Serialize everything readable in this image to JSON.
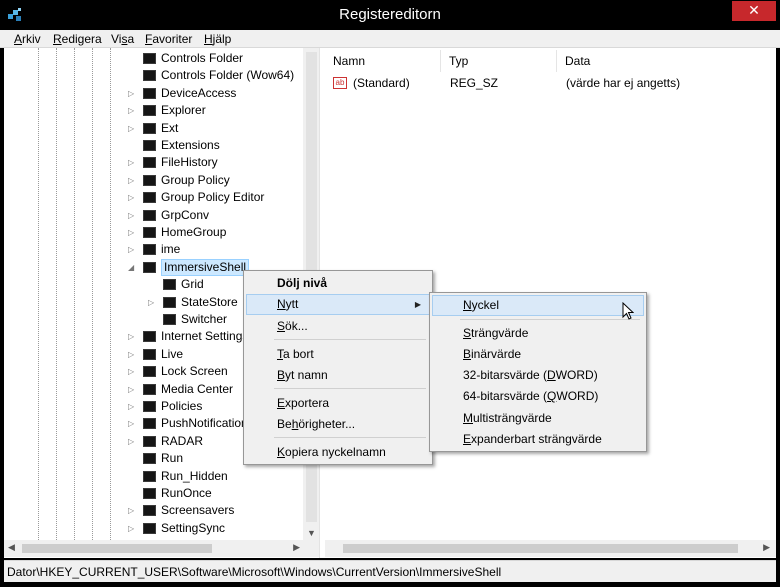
{
  "window": {
    "title": "Registereditorn",
    "close_glyph": "✕"
  },
  "menu": [
    {
      "label": "Arkiv",
      "accel": "A"
    },
    {
      "label": "Redigera",
      "accel": "R"
    },
    {
      "label": "Visa",
      "accel": "s"
    },
    {
      "label": "Favoriter",
      "accel": "F"
    },
    {
      "label": "Hjälp",
      "accel": "H"
    }
  ],
  "tree": {
    "items": [
      {
        "label": "Controls Folder",
        "expander": false
      },
      {
        "label": "Controls Folder (Wow64)",
        "expander": false
      },
      {
        "label": "DeviceAccess",
        "expander": true
      },
      {
        "label": "Explorer",
        "expander": true
      },
      {
        "label": "Ext",
        "expander": true
      },
      {
        "label": "Extensions",
        "expander": false
      },
      {
        "label": "FileHistory",
        "expander": true
      },
      {
        "label": "Group Policy",
        "expander": true
      },
      {
        "label": "Group Policy Editor",
        "expander": true
      },
      {
        "label": "GrpConv",
        "expander": true
      },
      {
        "label": "HomeGroup",
        "expander": true
      },
      {
        "label": "ime",
        "expander": true
      },
      {
        "label": "ImmersiveShell",
        "expander": true,
        "expanded": true,
        "selected": true
      },
      {
        "label": "Grid",
        "child": true,
        "expander": false
      },
      {
        "label": "StateStore",
        "child": true,
        "expander": true
      },
      {
        "label": "Switcher",
        "child": true,
        "expander": false
      },
      {
        "label": "Internet Settings",
        "expander": true
      },
      {
        "label": "Live",
        "expander": true
      },
      {
        "label": "Lock Screen",
        "expander": true
      },
      {
        "label": "Media Center",
        "expander": true
      },
      {
        "label": "Policies",
        "expander": true
      },
      {
        "label": "PushNotifications",
        "expander": true
      },
      {
        "label": "RADAR",
        "expander": true
      },
      {
        "label": "Run",
        "expander": false
      },
      {
        "label": "Run_Hidden",
        "expander": false
      },
      {
        "label": "RunOnce",
        "expander": false
      },
      {
        "label": "Screensavers",
        "expander": true
      },
      {
        "label": "SettingSync",
        "expander": true
      }
    ]
  },
  "list": {
    "columns": [
      "Namn",
      "Typ",
      "Data"
    ],
    "rows": [
      {
        "name": "(Standard)",
        "type": "REG_SZ",
        "data": "(värde har ej angetts)"
      }
    ]
  },
  "status": "Dator\\HKEY_CURRENT_USER\\Software\\Microsoft\\Windows\\CurrentVersion\\ImmersiveShell",
  "context_menu": {
    "items": [
      {
        "label": "Dölj nivå",
        "bold": true
      },
      {
        "label": "Nytt",
        "accel": "N",
        "submenu": true,
        "highlighted": true
      },
      {
        "label": "Sök...",
        "accel": "S"
      },
      {
        "label": "Ta bort",
        "accel": "T"
      },
      {
        "label": "Byt namn",
        "accel": "B"
      },
      {
        "label": "Exportera",
        "accel": "E"
      },
      {
        "label": "Behörigheter...",
        "accel": "h"
      },
      {
        "label": "Kopiera nyckelnamn",
        "accel": "K"
      }
    ]
  },
  "submenu": {
    "items": [
      {
        "label": "Nyckel",
        "accel": "N",
        "highlighted": true
      },
      {
        "label": "Strängvärde",
        "accel": "S"
      },
      {
        "label": "Binärvärde",
        "accel": "B"
      },
      {
        "label": "32-bitarsvärde (DWORD)",
        "accel": "D"
      },
      {
        "label": "64-bitarsvärde (QWORD)",
        "accel": "Q"
      },
      {
        "label": "Multisträngvärde",
        "accel": "M"
      },
      {
        "label": "Expanderbart strängvärde",
        "accel": "E"
      }
    ]
  },
  "icons": {
    "app": "registry-cubes-icon",
    "folder": "folder-icon",
    "string_value": "ab-string-icon",
    "cursor": "mouse-pointer-icon"
  },
  "colors": {
    "selection": "#cce8ff",
    "menu_highlight": "#dae9f8",
    "close": "#c7282c"
  }
}
